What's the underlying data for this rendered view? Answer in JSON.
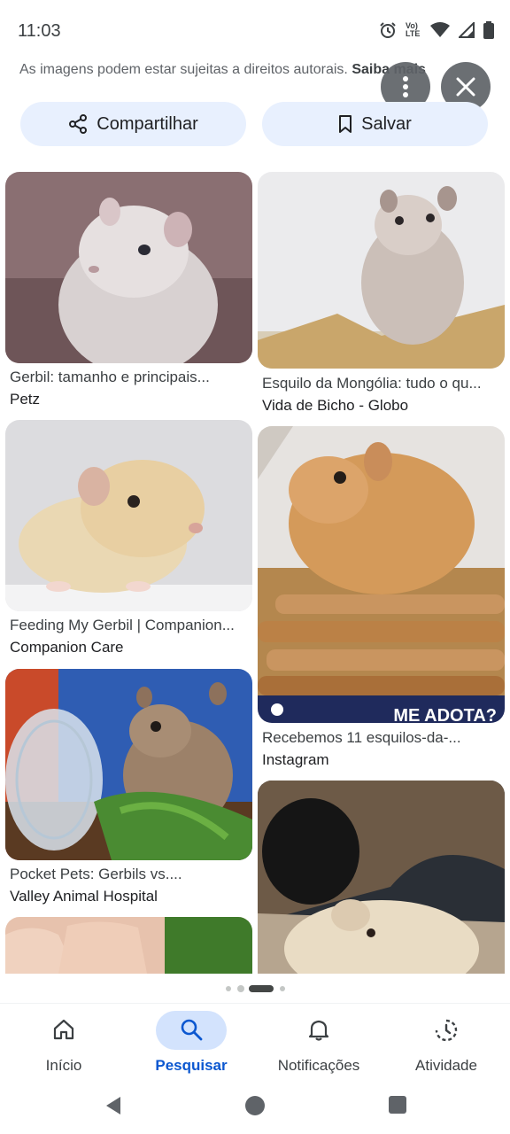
{
  "status": {
    "time": "11:03",
    "network_label": "Vo) LTE"
  },
  "banner": {
    "text": "As imagens podem estar sujeitas a direitos autorais.",
    "more": "Saiba mais"
  },
  "actions": {
    "share": "Compartilhar",
    "save": "Salvar"
  },
  "results": [
    {
      "title": "Gerbil: tamanho e principais...",
      "source": "Petz"
    },
    {
      "title": "Esquilo da Mongólia: tudo o qu...",
      "source": "Vida de Bicho - Globo"
    },
    {
      "title": "Feeding My Gerbil | Companion...",
      "source": "Companion Care"
    },
    {
      "title": "Recebemos 11 esquilos-da-...",
      "source": "Instagram",
      "overlay_text": "ME ADOTA?"
    },
    {
      "title": "Pocket Pets: Gerbils vs....",
      "source": "Valley Animal Hospital"
    }
  ],
  "carousel": {
    "pages": 4,
    "active_page": 3
  },
  "bottom_nav": [
    {
      "label": "Início",
      "icon": "home-icon"
    },
    {
      "label": "Pesquisar",
      "icon": "search-icon",
      "active": true
    },
    {
      "label": "Notificações",
      "icon": "bell-icon"
    },
    {
      "label": "Atividade",
      "icon": "activity-icon"
    }
  ],
  "colors": {
    "accent": "#0b57d0",
    "action_bg": "#e8f0fe",
    "nav_active_bg": "#d3e3fd"
  }
}
